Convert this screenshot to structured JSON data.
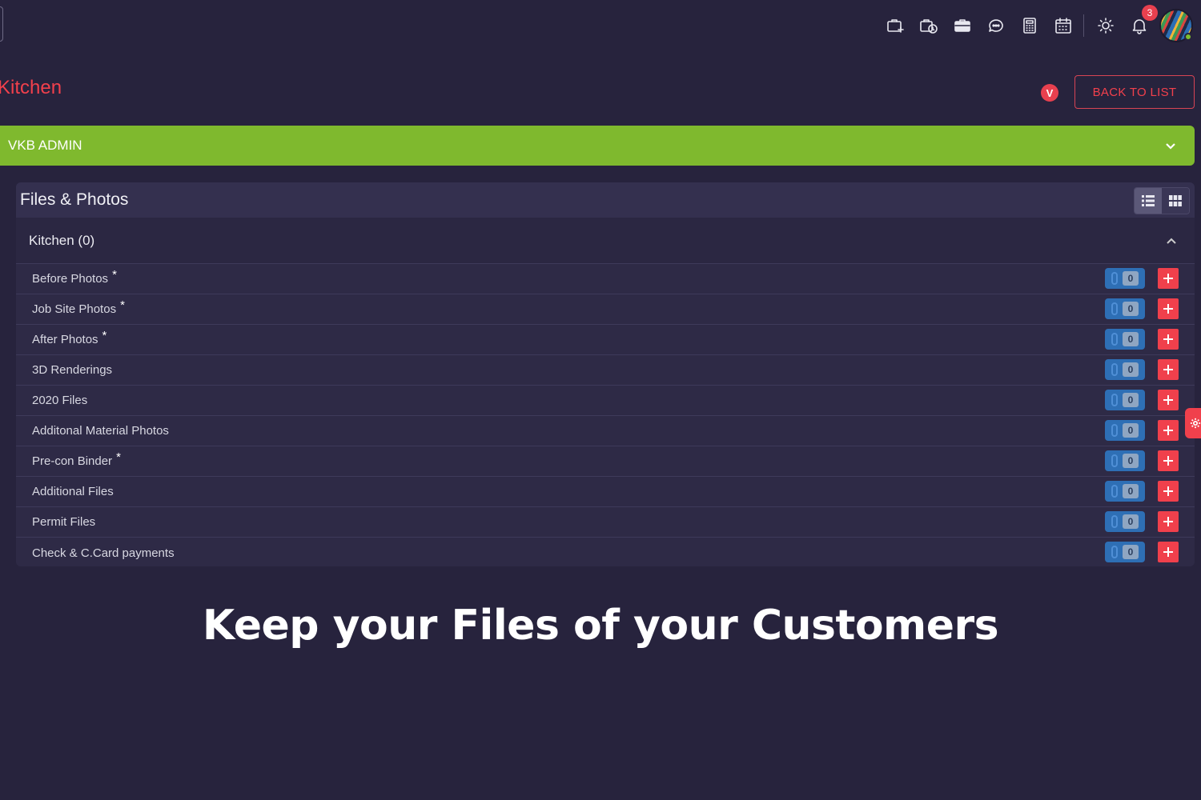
{
  "header": {
    "notification_count": "3"
  },
  "page": {
    "title": "Kitchen",
    "badge_letter": "V",
    "back_button_label": "BACK TO LIST"
  },
  "accordion": {
    "label": "VKB ADMIN"
  },
  "files_panel": {
    "title": "Files & Photos",
    "section_title": "Kitchen (0)",
    "rows": [
      {
        "label": "Before Photos",
        "required": true,
        "count": "0"
      },
      {
        "label": "Job Site Photos",
        "required": true,
        "count": "0"
      },
      {
        "label": "After Photos",
        "required": true,
        "count": "0"
      },
      {
        "label": "3D Renderings",
        "required": false,
        "count": "0"
      },
      {
        "label": "2020 Files",
        "required": false,
        "count": "0"
      },
      {
        "label": "Additonal Material Photos",
        "required": false,
        "count": "0"
      },
      {
        "label": "Pre-con Binder",
        "required": true,
        "count": "0"
      },
      {
        "label": "Additional Files",
        "required": false,
        "count": "0"
      },
      {
        "label": "Permit Files",
        "required": false,
        "count": "0"
      },
      {
        "label": "Check & C.Card payments",
        "required": false,
        "count": "0"
      }
    ]
  },
  "promo": {
    "caption": "Keep your Files of your Customers"
  },
  "colors": {
    "background": "#27233d",
    "accent_red": "#f0404c",
    "accent_green": "#7fb92e",
    "count_blue": "#2e6fb5"
  },
  "icons": [
    "add-job-icon",
    "job-schedule-icon",
    "briefcase-icon",
    "chat-icon",
    "calculator-icon",
    "calendar-icon",
    "brightness-icon",
    "bell-icon"
  ]
}
